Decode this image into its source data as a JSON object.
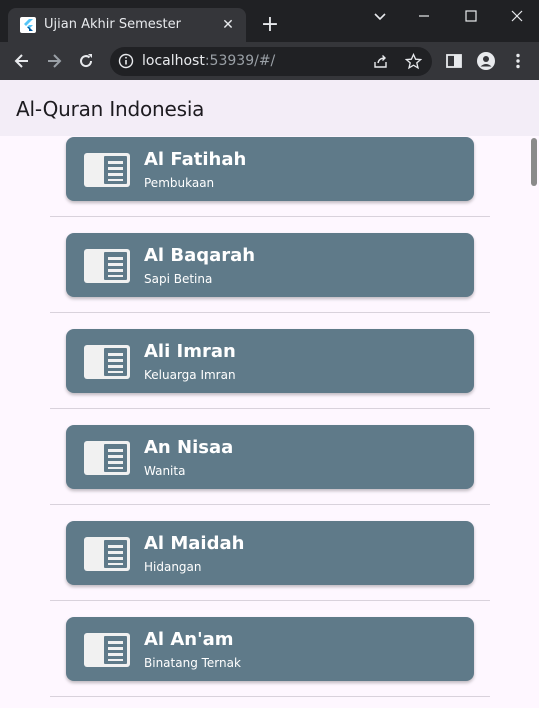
{
  "browser": {
    "tab_title": "Ujian Akhir Semester",
    "new_tab_label": "+",
    "url_host": "localhost",
    "url_rest": ":53939/#/"
  },
  "app": {
    "title": "Al-Quran Indonesia"
  },
  "surahs": [
    {
      "name": "Al Fatihah",
      "meaning": "Pembukaan"
    },
    {
      "name": "Al Baqarah",
      "meaning": "Sapi Betina"
    },
    {
      "name": "Ali Imran",
      "meaning": "Keluarga Imran"
    },
    {
      "name": "An Nisaa",
      "meaning": "Wanita"
    },
    {
      "name": "Al Maidah",
      "meaning": "Hidangan"
    },
    {
      "name": "Al An'am",
      "meaning": "Binatang Ternak"
    }
  ],
  "colors": {
    "card": "#5f7a89",
    "appbar": "#f3edf7",
    "background": "#fef7ff"
  },
  "icons": {
    "card": "article-icon"
  }
}
